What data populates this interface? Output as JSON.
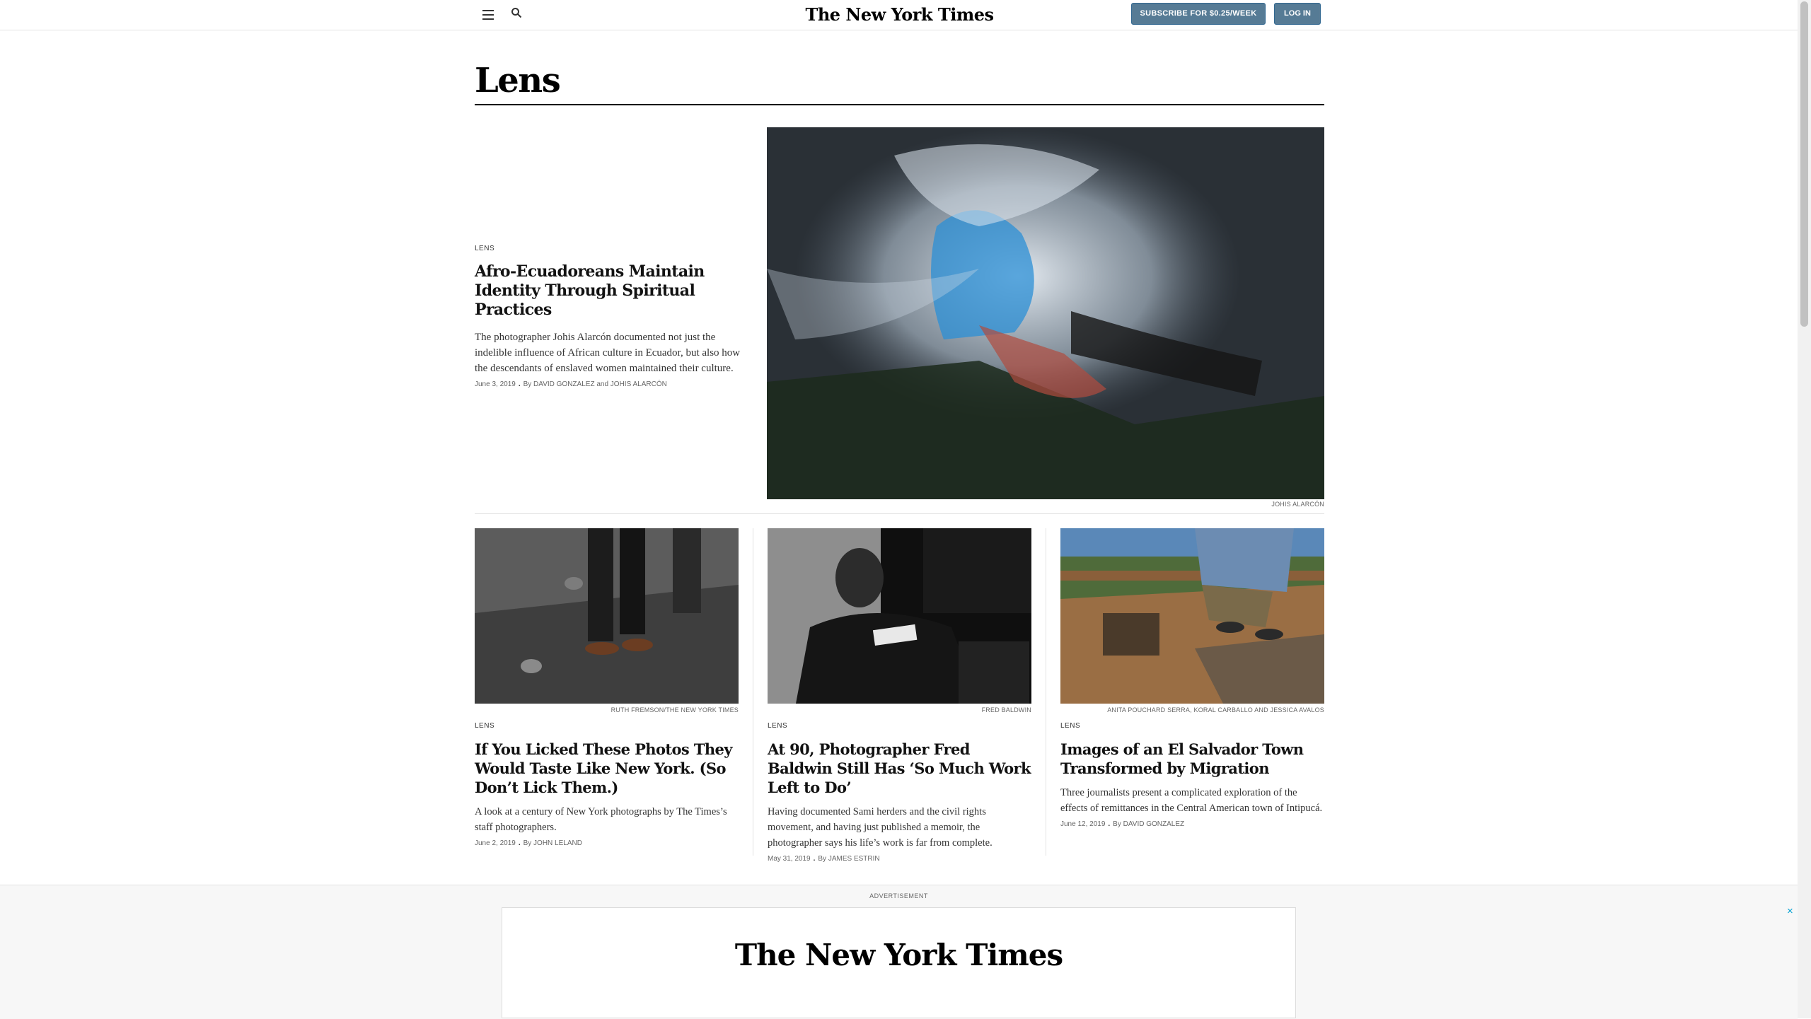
{
  "header": {
    "menu_icon": "hamburger-menu-icon",
    "search_icon": "search-icon",
    "masthead": "The New York Times",
    "subscribe_label": "SUBSCRIBE FOR $0.25/WEEK",
    "login_label": "LOG IN",
    "button_color": "#567b95"
  },
  "section": {
    "title": "Lens"
  },
  "lead": {
    "kicker": "LENS",
    "headline": "Afro-Ecuadoreans Maintain Identity Through Spiritual Practices",
    "summary": "The photographer Johis Alarcón documented not just the indelible influence of African culture in Ecuador, but also how the descendants of enslaved women maintained their culture.",
    "date": "June 3, 2019",
    "byline": "By DAVID GONZALEZ and JOHIS ALARCÓN",
    "photo_credit": "JOHIS ALARCÓN"
  },
  "stories": [
    {
      "photo_credit": "RUTH FREMSON/THE NEW YORK TIMES",
      "kicker": "LENS",
      "headline": "If You Licked These Photos They Would Taste Like New York. (So Don’t Lick Them.)",
      "summary": "A look at a century of New York photographs by The Times’s staff photographers.",
      "date": "June 2, 2019",
      "byline": "By JOHN LELAND"
    },
    {
      "photo_credit": "FRED BALDWIN",
      "kicker": "LENS",
      "headline": "At 90, Photographer Fred Baldwin Still Has ‘So Much Work Left to Do’",
      "summary": "Having documented Sami herders and the civil rights movement, and having just published a memoir, the photographer says his life’s work is far from complete.",
      "date": "May 31, 2019",
      "byline": "By JAMES ESTRIN"
    },
    {
      "photo_credit": "ANITA POUCHARD SERRA, KORAL CARBALLO AND JESSICA AVALOS",
      "kicker": "LENS",
      "headline": "Images of an El Salvador Town Transformed by Migration",
      "summary": "Three journalists present a complicated exploration of the effects of remittances in the Central American town of Intipucá.",
      "date": "June 12, 2019",
      "byline": "By DAVID GONZALEZ"
    }
  ],
  "ad": {
    "label": "ADVERTISEMENT",
    "logo": "The New York Times",
    "close_icon": "close-icon",
    "close_glyph": "×",
    "close_color": "#00a0d2"
  }
}
